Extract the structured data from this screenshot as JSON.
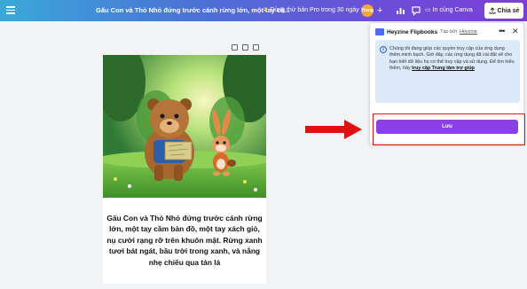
{
  "topbar": {
    "doc_title": "Gấu Con và Thỏ Nhỏ đứng trước cánh rừng lớn, một tay cầ...",
    "pro_offer": "Dùng thử bản Pro trong 30 ngày",
    "avatar_initials": "Trang",
    "print_label": "In cùng Canva",
    "share_label": "Chia sẻ"
  },
  "page": {
    "caption": "Gấu Con và Thỏ Nhỏ đứng trước cánh rừng lớn, một tay cầm bản đồ, một tay xách giỏ, nụ cười rạng rỡ trên khuôn mặt. Rừng xanh tươi bát ngát, bầu trời trong xanh, và nắng nhẹ chiếu qua tán lá"
  },
  "panel": {
    "app_name": "Heyzine Flipbooks",
    "by_label": "Tạo bởi",
    "by_link": "Heyzine",
    "info_text": "Chúng tôi đang giúp các quyền truy cập của ứng dụng thêm minh bạch. Giờ đây, các ứng dụng đã cài đặt sẽ cho bạn biết dữ liệu họ có thể truy cập và sử dụng. Để tìm hiểu thêm, hãy",
    "info_link": "truy cập Trung tâm trợ giúp",
    "save_label": "Lưu"
  },
  "colors": {
    "accent": "#8b3fe8",
    "highlight": "#e11111",
    "info_bg": "#dce9fb"
  }
}
